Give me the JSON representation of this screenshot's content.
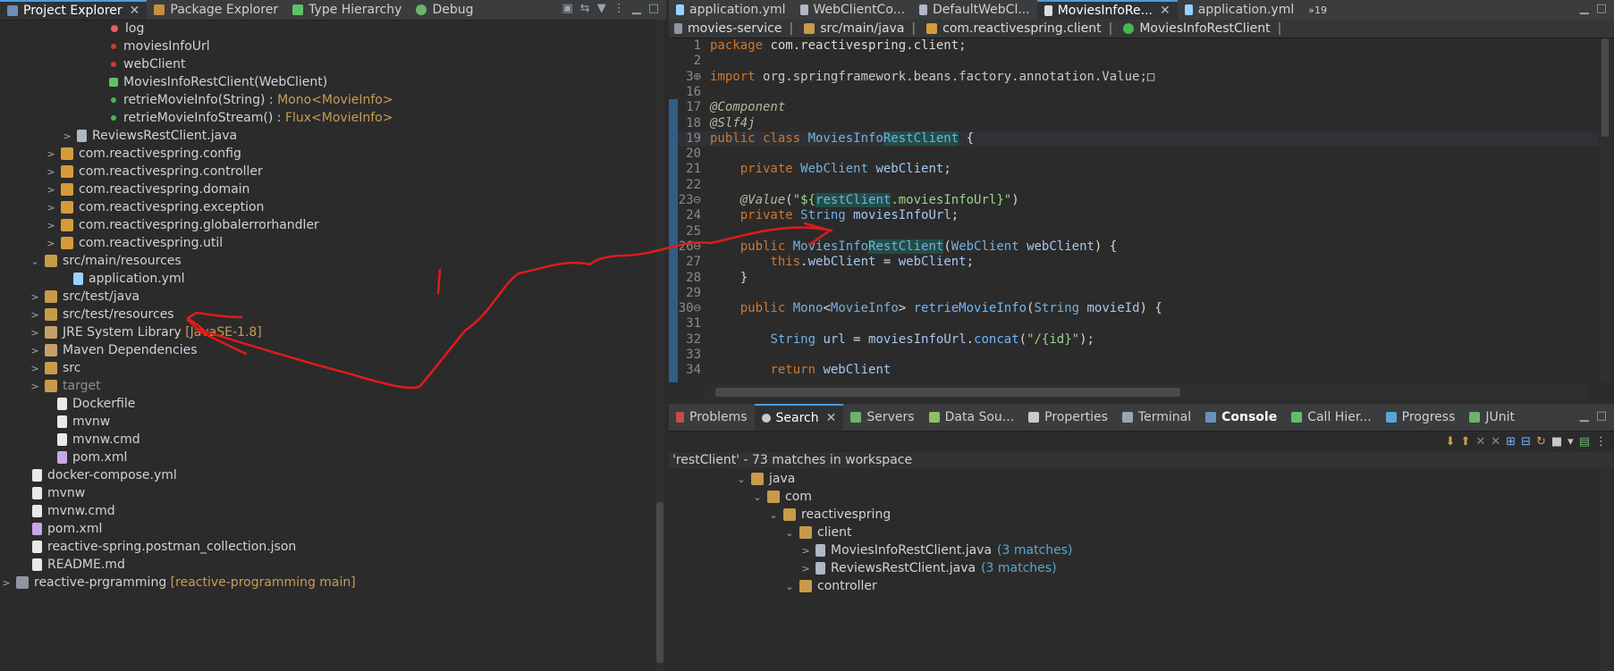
{
  "explorer": {
    "tabs": [
      {
        "label": "Project Explorer",
        "active": true
      },
      {
        "label": "Package Explorer",
        "active": false
      },
      {
        "label": "Type Hierarchy",
        "active": false
      },
      {
        "label": "Debug",
        "active": false
      }
    ],
    "rows": [
      {
        "label": "log",
        "extra": "",
        "icon": "field-icon"
      },
      {
        "label": "moviesInfoUrl",
        "extra": "",
        "icon": "private-field-icon"
      },
      {
        "label": "webClient",
        "extra": "",
        "icon": "private-field-icon"
      },
      {
        "label": "MoviesInfoRestClient(WebClient)",
        "extra": "",
        "icon": "constructor-icon"
      },
      {
        "label": "retrieMovieInfo(String) :",
        "extra": "Mono<MovieInfo>",
        "icon": "public-method-icon"
      },
      {
        "label": "retrieMovieInfoStream() :",
        "extra": "Flux<MovieInfo>",
        "icon": "public-method-icon"
      },
      {
        "label": "ReviewsRestClient.java",
        "extra": "",
        "icon": "java-file-icon"
      },
      {
        "label": "com.reactivespring.config",
        "extra": "",
        "icon": "package-icon"
      },
      {
        "label": "com.reactivespring.controller",
        "extra": "",
        "icon": "package-icon"
      },
      {
        "label": "com.reactivespring.domain",
        "extra": "",
        "icon": "package-icon"
      },
      {
        "label": "com.reactivespring.exception",
        "extra": "",
        "icon": "package-icon"
      },
      {
        "label": "com.reactivespring.globalerrorhandler",
        "extra": "",
        "icon": "package-icon"
      },
      {
        "label": "com.reactivespring.util",
        "extra": "",
        "icon": "package-icon"
      },
      {
        "label": "src/main/resources",
        "extra": "",
        "icon": "source-folder-icon"
      },
      {
        "label": "application.yml",
        "extra": "",
        "icon": "yml-file-icon"
      },
      {
        "label": "src/test/java",
        "extra": "",
        "icon": "source-folder-icon"
      },
      {
        "label": "src/test/resources",
        "extra": "",
        "icon": "source-folder-icon"
      },
      {
        "label": "JRE System Library",
        "extra": "[JavaSE-1.8]",
        "icon": "library-icon"
      },
      {
        "label": "Maven Dependencies",
        "extra": "",
        "icon": "library-icon"
      },
      {
        "label": "src",
        "extra": "",
        "icon": "folder-icon"
      },
      {
        "label": "target",
        "extra": "",
        "icon": "folder-icon"
      },
      {
        "label": "Dockerfile",
        "extra": "",
        "icon": "file-icon"
      },
      {
        "label": "mvnw",
        "extra": "",
        "icon": "file-icon"
      },
      {
        "label": "mvnw.cmd",
        "extra": "",
        "icon": "file-icon"
      },
      {
        "label": "pom.xml",
        "extra": "",
        "icon": "xml-file-icon"
      },
      {
        "label": "docker-compose.yml",
        "extra": "",
        "icon": "file-icon"
      },
      {
        "label": "mvnw",
        "extra": "",
        "icon": "file-icon"
      },
      {
        "label": "mvnw.cmd",
        "extra": "",
        "icon": "file-icon"
      },
      {
        "label": "pom.xml",
        "extra": "",
        "icon": "xml-file-icon"
      },
      {
        "label": "reactive-spring.postman_collection.json",
        "extra": "",
        "icon": "file-icon"
      },
      {
        "label": "README.md",
        "extra": "",
        "icon": "file-icon"
      },
      {
        "label": "reactive-prgramming",
        "extra": "[reactive-programming main]",
        "icon": "project-icon"
      }
    ]
  },
  "editor": {
    "tabs": [
      {
        "label": "application.yml",
        "active": false
      },
      {
        "label": "WebClientCo...",
        "active": false
      },
      {
        "label": "DefaultWebCl...",
        "active": false
      },
      {
        "label": "MoviesInfoRe...",
        "active": true
      },
      {
        "label": "application.yml",
        "active": false
      }
    ],
    "overflow": "»19",
    "breadcrumbs": [
      "movies-service",
      "src/main/java",
      "com.reactivespring.client",
      "MoviesInfoRestClient"
    ],
    "lines": [
      {
        "n": "1",
        "parts": [
          [
            "kw",
            "package "
          ],
          [
            "plain",
            "com.reactivespring.client;"
          ]
        ]
      },
      {
        "n": "2",
        "parts": []
      },
      {
        "n": "3⊕",
        "parts": [
          [
            "kw",
            "import "
          ],
          [
            "imp",
            "org.springframework.beans.factory.annotation.Value;"
          ],
          [
            "plain",
            "□"
          ]
        ]
      },
      {
        "n": "16",
        "parts": []
      },
      {
        "n": "17",
        "parts": [
          [
            "ann",
            "@Component"
          ]
        ]
      },
      {
        "n": "18",
        "parts": [
          [
            "ann",
            "@Slf4j"
          ]
        ]
      },
      {
        "n": "19",
        "parts": [
          [
            "kw",
            "public class "
          ],
          [
            "cls",
            "MoviesInfo"
          ],
          [
            "hl",
            "RestClient"
          ],
          [
            "plain",
            " {"
          ]
        ]
      },
      {
        "n": "20",
        "parts": []
      },
      {
        "n": "21",
        "parts": [
          [
            "plain",
            "    "
          ],
          [
            "kw",
            "private "
          ],
          [
            "cls",
            "WebClient "
          ],
          [
            "var",
            "webClient"
          ],
          [
            "plain",
            ";"
          ]
        ]
      },
      {
        "n": "22",
        "parts": []
      },
      {
        "n": "23⊖",
        "parts": [
          [
            "plain",
            "    "
          ],
          [
            "ann",
            "@Value"
          ],
          [
            "plain",
            "("
          ],
          [
            "str",
            "\"${"
          ],
          [
            "hl",
            "restClient"
          ],
          [
            "str",
            ".moviesInfoUrl}\""
          ],
          [
            "plain",
            ")"
          ]
        ]
      },
      {
        "n": "24",
        "parts": [
          [
            "plain",
            "    "
          ],
          [
            "kw",
            "private "
          ],
          [
            "cls",
            "String "
          ],
          [
            "var",
            "moviesInfoUrl"
          ],
          [
            "plain",
            ";"
          ]
        ]
      },
      {
        "n": "25",
        "parts": []
      },
      {
        "n": "26⊖",
        "parts": [
          [
            "plain",
            "    "
          ],
          [
            "kw",
            "public "
          ],
          [
            "cls",
            "MoviesInfo"
          ],
          [
            "hl",
            "RestClient"
          ],
          [
            "plain",
            "("
          ],
          [
            "cls",
            "WebClient "
          ],
          [
            "var",
            "webClient"
          ],
          [
            "plain",
            ") {"
          ]
        ]
      },
      {
        "n": "27",
        "parts": [
          [
            "plain",
            "        "
          ],
          [
            "kw",
            "this"
          ],
          [
            "plain",
            "."
          ],
          [
            "var",
            "webClient"
          ],
          [
            "plain",
            " = "
          ],
          [
            "var",
            "webClient"
          ],
          [
            "plain",
            ";"
          ]
        ]
      },
      {
        "n": "28",
        "parts": [
          [
            "plain",
            "    }"
          ]
        ]
      },
      {
        "n": "29",
        "parts": []
      },
      {
        "n": "30⊖",
        "parts": [
          [
            "plain",
            "    "
          ],
          [
            "kw",
            "public "
          ],
          [
            "cls",
            "Mono"
          ],
          [
            "plain",
            "<"
          ],
          [
            "cls",
            "MovieInfo"
          ],
          [
            "plain",
            "> "
          ],
          [
            "meth",
            "retrieMovieInfo"
          ],
          [
            "plain",
            "("
          ],
          [
            "cls",
            "String "
          ],
          [
            "var",
            "movieId"
          ],
          [
            "plain",
            ") {"
          ]
        ]
      },
      {
        "n": "31",
        "parts": []
      },
      {
        "n": "32",
        "parts": [
          [
            "plain",
            "        "
          ],
          [
            "cls",
            "String "
          ],
          [
            "var",
            "url"
          ],
          [
            "plain",
            " = "
          ],
          [
            "var",
            "moviesInfoUrl"
          ],
          [
            "plain",
            "."
          ],
          [
            "meth",
            "concat"
          ],
          [
            "plain",
            "("
          ],
          [
            "str",
            "\"/{id}\""
          ],
          [
            "plain",
            ");"
          ]
        ]
      },
      {
        "n": "33",
        "parts": []
      },
      {
        "n": "34",
        "parts": [
          [
            "plain",
            "        "
          ],
          [
            "kw",
            "return "
          ],
          [
            "var",
            "webClient"
          ]
        ]
      }
    ]
  },
  "search": {
    "tabs": [
      {
        "label": "Problems",
        "active": false
      },
      {
        "label": "Search",
        "active": true
      },
      {
        "label": "Servers",
        "active": false
      },
      {
        "label": "Data Sou...",
        "active": false
      },
      {
        "label": "Properties",
        "active": false
      },
      {
        "label": "Terminal",
        "active": false
      },
      {
        "label": "Console",
        "active": false
      },
      {
        "label": "Call Hier...",
        "active": false
      },
      {
        "label": "Progress",
        "active": false
      },
      {
        "label": "JUnit",
        "active": false
      }
    ],
    "status": "'restClient' - 73 matches in workspace",
    "rows": [
      {
        "label": "java",
        "matches": ""
      },
      {
        "label": "com",
        "matches": ""
      },
      {
        "label": "reactivespring",
        "matches": ""
      },
      {
        "label": "client",
        "matches": ""
      },
      {
        "label": "MoviesInfoRestClient.java",
        "matches": "(3 matches)"
      },
      {
        "label": "ReviewsRestClient.java",
        "matches": "(3 matches)"
      },
      {
        "label": "controller",
        "matches": ""
      }
    ]
  },
  "colors": {
    "accent": "#4a9de0",
    "annotation_stroke": "#e01b1b"
  }
}
